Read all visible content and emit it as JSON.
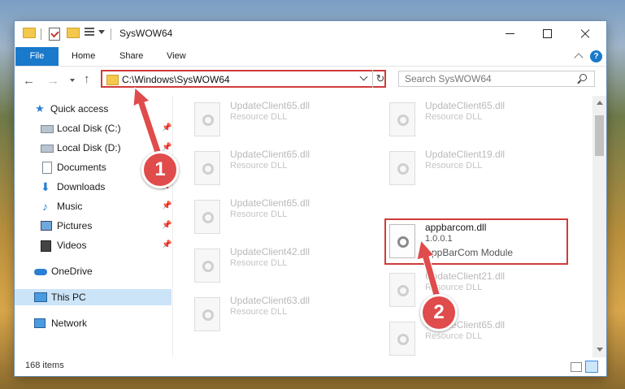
{
  "window": {
    "title": "SysWOW64"
  },
  "ribbon": {
    "tabs": [
      "File",
      "Home",
      "Share",
      "View"
    ],
    "help": "?"
  },
  "address": {
    "path": "C:\\Windows\\SysWOW64",
    "search_placeholder": "Search SysWOW64",
    "refresh": "↻"
  },
  "nav": {
    "back": "←",
    "forward": "→",
    "up": "↑",
    "items": [
      {
        "label": "Quick access",
        "icon": "star-icon"
      },
      {
        "label": "Local Disk (C:)",
        "icon": "drive-icon",
        "pinned": true
      },
      {
        "label": "Local Disk (D:)",
        "icon": "drive-icon",
        "pinned": true
      },
      {
        "label": "Documents",
        "icon": "documents-icon",
        "pinned": true
      },
      {
        "label": "Downloads",
        "icon": "downloads-icon",
        "pinned": true
      },
      {
        "label": "Music",
        "icon": "music-icon",
        "pinned": true
      },
      {
        "label": "Pictures",
        "icon": "pictures-icon",
        "pinned": true
      },
      {
        "label": "Videos",
        "icon": "videos-icon",
        "pinned": true
      },
      {
        "label": "OneDrive",
        "icon": "onedrive-icon"
      },
      {
        "label": "This PC",
        "icon": "pc-icon",
        "selected": true
      },
      {
        "label": "Network",
        "icon": "network-icon"
      }
    ],
    "pin_glyph": "📌"
  },
  "files": [
    {
      "name": "UpdateClient65.dll",
      "desc": "Resource DLL"
    },
    {
      "name": "UpdateClient65.dll",
      "desc": "Resource DLL"
    },
    {
      "name": "UpdateClient65.dll",
      "desc": "Resource DLL"
    },
    {
      "name": "UpdateClient19.dll",
      "desc": "Resource DLL"
    },
    {
      "name": "UpdateClient65.dll",
      "desc": "Resource DLL"
    },
    {
      "name": "appbarcom.dll",
      "version": "1.0.0.1",
      "desc": "AppBarCom Module",
      "highlighted": true
    },
    {
      "name": "UpdateClient42.dll",
      "desc": "Resource DLL"
    },
    {
      "name": "UpdateClient21.dll",
      "desc": "Resource DLL"
    },
    {
      "name": "UpdateClient63.dll",
      "desc": "Resource DLL"
    },
    {
      "name": "UpdateClient65.dll",
      "desc": "Resource DLL"
    }
  ],
  "status": {
    "items": "168 items"
  },
  "annotations": {
    "step1": "1",
    "step2": "2",
    "color": "#e04b4b"
  }
}
